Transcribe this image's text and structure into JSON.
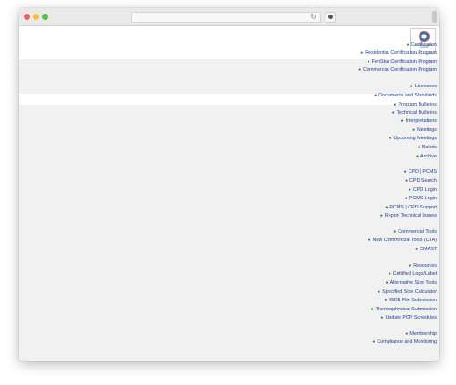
{
  "browser": {
    "url_text": "",
    "reload_icon": "reload-icon",
    "settings_icon": "settings-icon"
  },
  "site": {
    "logo_text": "Cool Roof Rating Council"
  },
  "menu": {
    "items": [
      {
        "label": "Certification",
        "level": 1
      },
      {
        "label": "Residential Certification Program",
        "level": 2
      },
      {
        "label": "FenStar Certification Program",
        "level": 2
      },
      {
        "label": "Commercial Certification Program",
        "level": 2
      },
      {
        "label": "Licensees",
        "level": 1
      },
      {
        "label": "Documents and Standards",
        "level": 2
      },
      {
        "label": "Program Bulletins",
        "level": 2
      },
      {
        "label": "Technical Bulletins",
        "level": 2
      },
      {
        "label": "Interpretations",
        "level": 2
      },
      {
        "label": "Meetings",
        "level": 2
      },
      {
        "label": "Upcoming Meetings",
        "level": 2
      },
      {
        "label": "Ballots",
        "level": 2
      },
      {
        "label": "Archive",
        "level": 2
      },
      {
        "label": "CPD | PCMS",
        "level": 1
      },
      {
        "label": "CPD Search",
        "level": 2
      },
      {
        "label": "CPD Login",
        "level": 2
      },
      {
        "label": "PCMS Login",
        "level": 2
      },
      {
        "label": "PCMS | CPD Support",
        "level": 2
      },
      {
        "label": "Report Technical Issues",
        "level": 2
      },
      {
        "label": "Commercial Tools",
        "level": 1
      },
      {
        "label": "New Commercial Tools (CTA)",
        "level": 2
      },
      {
        "label": "CMAST",
        "level": 2
      },
      {
        "label": "Resources",
        "level": 1
      },
      {
        "label": "Certified Logo/Label",
        "level": 2
      },
      {
        "label": "Alternative Size Tools",
        "level": 2
      },
      {
        "label": "Specified Size Calculator",
        "level": 2
      },
      {
        "label": "IGDB File Submission",
        "level": 2
      },
      {
        "label": "Thermophysical Submission",
        "level": 2
      },
      {
        "label": "Update PCP Schedules",
        "level": 2
      },
      {
        "label": "Membership",
        "level": 1
      },
      {
        "label": "Compliance and Monitoring",
        "level": 2
      }
    ]
  },
  "colors": {
    "link": "#1c3f94",
    "bullet": "#2b8a3e",
    "band": "#f1f1f1"
  }
}
